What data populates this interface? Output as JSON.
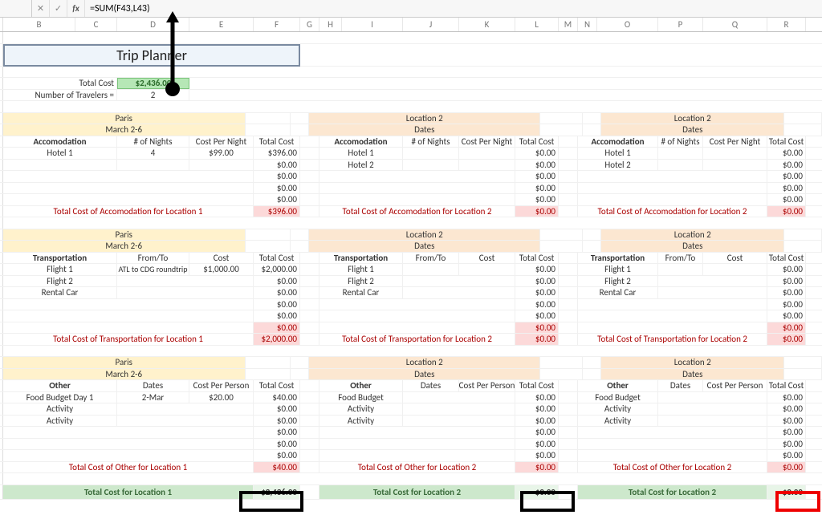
{
  "formula_bar": {
    "formula": "=SUM(F43,L43)"
  },
  "columns": [
    "B",
    "C",
    "D",
    "E",
    "F",
    "G",
    "H",
    "I",
    "J",
    "K",
    "L",
    "M",
    "N",
    "O",
    "P",
    "Q",
    "R"
  ],
  "title": "Trip Planner",
  "summary": {
    "total_cost_label": "Total Cost",
    "total_cost_value": "$2,436.00",
    "num_travelers_label": "Number of Travelers  =",
    "num_travelers_value": "2"
  },
  "block1": {
    "loc1_name": "Paris",
    "loc1_dates": "March 2-6",
    "loc2_name": "Location 2",
    "loc2_dates": "Dates",
    "loc3_name": "Location 2",
    "loc3_dates": "Dates",
    "h_accom": "Accomodation",
    "h_nights": "# of Nights",
    "h_cpn": "Cost Per Night",
    "h_tc": "Total Cost",
    "r_hotel1": "Hotel 1",
    "r_hotel2": "Hotel 2",
    "l1_nights": "4",
    "l1_cpn": "$99.00",
    "l1_tc": [
      "$396.00",
      "$0.00",
      "$0.00",
      "$0.00",
      "$0.00"
    ],
    "l2_tc": [
      "$0.00",
      "$0.00",
      "$0.00",
      "$0.00",
      "$0.00"
    ],
    "l3_tc": [
      "$0.00",
      "$0.00",
      "$0.00",
      "$0.00",
      "$0.00"
    ],
    "sub_l1": "Total Cost of Accomodation for Location 1",
    "sub_l1_v": "$396.00",
    "sub_l2": "Total Cost of Accomodation for Location 2",
    "sub_l2_v": "$0.00",
    "sub_l3": "Total Cost of Accomodation for Location 2",
    "sub_l3_v": "$0.00"
  },
  "block2": {
    "loc1_name": "Paris",
    "loc1_dates": "March 2-6",
    "loc2_name": "Location 2",
    "loc2_dates": "Dates",
    "loc3_name": "Location 2",
    "loc3_dates": "Dates",
    "h_trans": "Transportation",
    "h_fromto": "From/To",
    "h_cost": "Cost",
    "h_tc": "Total Cost",
    "r_f1": "Flight 1",
    "r_f2": "Flight 2",
    "r_rc": "Rental Car",
    "l1_fromto": "ATL to CDG roundtrip",
    "l1_cost": "$1,000.00",
    "l1_tc": [
      "$2,000.00",
      "$0.00",
      "$0.00",
      "$0.00",
      "$0.00",
      "$0.00"
    ],
    "l2_tc": [
      "$0.00",
      "$0.00",
      "$0.00",
      "$0.00",
      "$0.00",
      "$0.00"
    ],
    "l3_tc": [
      "$0.00",
      "$0.00",
      "$0.00",
      "$0.00",
      "$0.00",
      "$0.00"
    ],
    "sub_l1": "Total Cost of Transportation for Location 1",
    "sub_l1_v": "$2,000.00",
    "sub_l2": "Total Cost of Transportation for Location 2",
    "sub_l2_v": "$0.00",
    "sub_l3": "Total Cost of Transportation for Location 2",
    "sub_l3_v": "$0.00"
  },
  "block3": {
    "loc1_name": "Paris",
    "loc1_dates": "March 2-6",
    "loc2_name": "Location 2",
    "loc2_dates": "Dates",
    "loc3_name": "Location 2",
    "loc3_dates": "Dates",
    "h_other": "Other",
    "h_dates": "Dates",
    "h_cpp": "Cost Per Person",
    "h_tc": "Total Cost",
    "r_fb1": "Food Budget Day 1",
    "r_fb": "Food Budget",
    "r_act": "Activity",
    "l1_date": "2-Mar",
    "l1_cpp": "$20.00",
    "l1_tc": [
      "$40.00",
      "$0.00",
      "$0.00",
      "$0.00",
      "$0.00",
      "$0.00"
    ],
    "l2_tc": [
      "$0.00",
      "$0.00",
      "$0.00",
      "$0.00",
      "$0.00",
      "$0.00"
    ],
    "l3_tc": [
      "$0.00",
      "$0.00",
      "$0.00",
      "$0.00",
      "$0.00",
      "$0.00"
    ],
    "sub_l1": "Total Cost of Other for Location 1",
    "sub_l1_v": "$40.00",
    "sub_l2": "Total Cost of Other for Location 2",
    "sub_l2_v": "$0.00",
    "sub_l3": "Total Cost of Other for Location 2",
    "sub_l3_v": "$0.00"
  },
  "grand": {
    "l1": "Total Cost for Location 1",
    "l1_v": "$2,436.00",
    "l2": "Total Cost for Location 2",
    "l2_v": "$0.00",
    "l3": "Total Cost for Location 2",
    "l3_v": "$0.00"
  },
  "chart_data": {
    "type": "table",
    "title": "Trip Planner",
    "totals": {
      "grand_total": 2436.0,
      "travelers": 2
    },
    "locations": [
      {
        "name": "Paris",
        "dates": "March 2-6",
        "accommodation": [
          {
            "item": "Hotel 1",
            "nights": 4,
            "cost_per_night": 99.0,
            "total": 396.0
          }
        ],
        "accommodation_total": 396.0,
        "transportation": [
          {
            "item": "Flight 1",
            "from_to": "ATL to CDG roundtrip",
            "cost": 1000.0,
            "total": 2000.0
          }
        ],
        "transportation_total": 2000.0,
        "other": [
          {
            "item": "Food Budget Day 1",
            "date": "2-Mar",
            "cost_per_person": 20.0,
            "total": 40.0
          }
        ],
        "other_total": 40.0,
        "location_total": 2436.0
      },
      {
        "name": "Location 2",
        "dates": "Dates",
        "accommodation_total": 0,
        "transportation_total": 0,
        "other_total": 0,
        "location_total": 0
      },
      {
        "name": "Location 2",
        "dates": "Dates",
        "accommodation_total": 0,
        "transportation_total": 0,
        "other_total": 0,
        "location_total": 0
      }
    ]
  }
}
